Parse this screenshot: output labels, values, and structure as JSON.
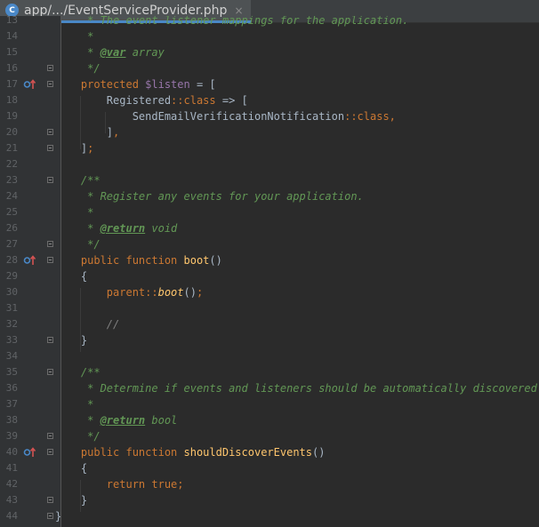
{
  "tab": {
    "icon_letter": "C",
    "title": "app/.../EventServiceProvider.php",
    "close": "×"
  },
  "editor": {
    "first_line": 13,
    "lines": [
      {
        "n": "13",
        "mark": false,
        "fold": false,
        "tokens": [
          {
            "c": "t-c",
            "t": "     * The event listener mappings for the application."
          }
        ]
      },
      {
        "n": "14",
        "mark": false,
        "fold": false,
        "tokens": [
          {
            "c": "t-c",
            "t": "     *"
          }
        ]
      },
      {
        "n": "15",
        "mark": false,
        "fold": false,
        "tokens": [
          {
            "c": "t-c",
            "t": "     * "
          },
          {
            "c": "t-tag",
            "t": "@var"
          },
          {
            "c": "t-c",
            "t": " array"
          }
        ]
      },
      {
        "n": "16",
        "mark": false,
        "fold": true,
        "tokens": [
          {
            "c": "t-c",
            "t": "     */"
          }
        ]
      },
      {
        "n": "17",
        "mark": true,
        "fold": true,
        "tokens": [
          {
            "c": "t-k",
            "t": "    protected "
          },
          {
            "c": "t-v",
            "t": "$listen"
          },
          {
            "c": "t-p",
            "t": " = ["
          }
        ]
      },
      {
        "n": "18",
        "mark": false,
        "fold": false,
        "tokens": [
          {
            "c": "t-p",
            "t": "        Registered"
          },
          {
            "c": "t-k",
            "t": "::class"
          },
          {
            "c": "t-p",
            "t": " => ["
          }
        ]
      },
      {
        "n": "19",
        "mark": false,
        "fold": false,
        "tokens": [
          {
            "c": "t-p",
            "t": "            SendEmailVerificationNotification"
          },
          {
            "c": "t-k",
            "t": "::class,"
          }
        ]
      },
      {
        "n": "20",
        "mark": false,
        "fold": true,
        "tokens": [
          {
            "c": "t-p",
            "t": "        ]"
          },
          {
            "c": "t-k",
            "t": ","
          }
        ]
      },
      {
        "n": "21",
        "mark": false,
        "fold": true,
        "tokens": [
          {
            "c": "t-p",
            "t": "    ]"
          },
          {
            "c": "t-k",
            "t": ";"
          }
        ]
      },
      {
        "n": "22",
        "mark": false,
        "fold": false,
        "tokens": []
      },
      {
        "n": "23",
        "mark": false,
        "fold": true,
        "tokens": [
          {
            "c": "t-c",
            "t": "    /**"
          }
        ]
      },
      {
        "n": "24",
        "mark": false,
        "fold": false,
        "tokens": [
          {
            "c": "t-c",
            "t": "     * Register any events for your application."
          }
        ]
      },
      {
        "n": "25",
        "mark": false,
        "fold": false,
        "tokens": [
          {
            "c": "t-c",
            "t": "     *"
          }
        ]
      },
      {
        "n": "26",
        "mark": false,
        "fold": false,
        "tokens": [
          {
            "c": "t-c",
            "t": "     * "
          },
          {
            "c": "t-tag",
            "t": "@return"
          },
          {
            "c": "t-c",
            "t": " void"
          }
        ]
      },
      {
        "n": "27",
        "mark": false,
        "fold": true,
        "tokens": [
          {
            "c": "t-c",
            "t": "     */"
          }
        ]
      },
      {
        "n": "28",
        "mark": true,
        "fold": true,
        "tokens": [
          {
            "c": "t-k",
            "t": "    public function "
          },
          {
            "c": "t-f",
            "t": "boot"
          },
          {
            "c": "t-p",
            "t": "()"
          }
        ]
      },
      {
        "n": "29",
        "mark": false,
        "fold": false,
        "tokens": [
          {
            "c": "t-p",
            "t": "    {"
          }
        ]
      },
      {
        "n": "30",
        "mark": false,
        "fold": false,
        "tokens": [
          {
            "c": "t-k",
            "t": "        parent::"
          },
          {
            "c": "t-fi",
            "t": "boot"
          },
          {
            "c": "t-p",
            "t": "()"
          },
          {
            "c": "t-k",
            "t": ";"
          }
        ]
      },
      {
        "n": "31",
        "mark": false,
        "fold": false,
        "tokens": []
      },
      {
        "n": "32",
        "mark": false,
        "fold": false,
        "tokens": [
          {
            "c": "t-lc",
            "t": "        //"
          }
        ]
      },
      {
        "n": "33",
        "mark": false,
        "fold": true,
        "tokens": [
          {
            "c": "t-p",
            "t": "    }"
          }
        ]
      },
      {
        "n": "34",
        "mark": false,
        "fold": false,
        "tokens": []
      },
      {
        "n": "35",
        "mark": false,
        "fold": true,
        "tokens": [
          {
            "c": "t-c",
            "t": "    /**"
          }
        ]
      },
      {
        "n": "36",
        "mark": false,
        "fold": false,
        "tokens": [
          {
            "c": "t-c",
            "t": "     * Determine if events and listeners should be automatically discovered."
          }
        ]
      },
      {
        "n": "37",
        "mark": false,
        "fold": false,
        "tokens": [
          {
            "c": "t-c",
            "t": "     *"
          }
        ]
      },
      {
        "n": "38",
        "mark": false,
        "fold": false,
        "tokens": [
          {
            "c": "t-c",
            "t": "     * "
          },
          {
            "c": "t-tag",
            "t": "@return"
          },
          {
            "c": "t-c",
            "t": " bool"
          }
        ]
      },
      {
        "n": "39",
        "mark": false,
        "fold": true,
        "tokens": [
          {
            "c": "t-c",
            "t": "     */"
          }
        ]
      },
      {
        "n": "40",
        "mark": true,
        "fold": true,
        "tokens": [
          {
            "c": "t-k",
            "t": "    public function "
          },
          {
            "c": "t-f",
            "t": "shouldDiscoverEvents"
          },
          {
            "c": "t-p",
            "t": "()"
          }
        ]
      },
      {
        "n": "41",
        "mark": false,
        "fold": false,
        "tokens": [
          {
            "c": "t-p",
            "t": "    {"
          }
        ]
      },
      {
        "n": "42",
        "mark": false,
        "fold": false,
        "tokens": [
          {
            "c": "t-k",
            "t": "        return true;"
          }
        ]
      },
      {
        "n": "43",
        "mark": false,
        "fold": true,
        "tokens": [
          {
            "c": "t-p",
            "t": "    }"
          }
        ]
      },
      {
        "n": "44",
        "mark": false,
        "fold": true,
        "tokens": [
          {
            "c": "t-p",
            "t": "}"
          }
        ]
      }
    ]
  }
}
